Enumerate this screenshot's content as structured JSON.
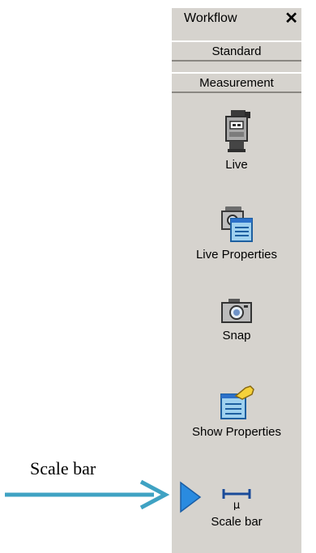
{
  "annotation": {
    "label": "Scale bar"
  },
  "panel": {
    "title": "Workflow",
    "close_glyph": "✕",
    "tabs": [
      {
        "label": "Standard"
      },
      {
        "label": "Measurement"
      }
    ],
    "tools": [
      {
        "label": "Live",
        "icon": "video-camera-icon"
      },
      {
        "label": "Live Properties",
        "icon": "camera-properties-icon"
      },
      {
        "label": "Snap",
        "icon": "camera-icon"
      },
      {
        "label": "Show Properties",
        "icon": "pointing-hand-properties-icon"
      },
      {
        "label": "Scale bar",
        "icon": "scale-bar-mu-icon"
      }
    ]
  },
  "colors": {
    "panel_bg": "#d6d3ce",
    "annotation_arrow": "#3fa2c3",
    "play_triangle": "#2a8be0"
  }
}
